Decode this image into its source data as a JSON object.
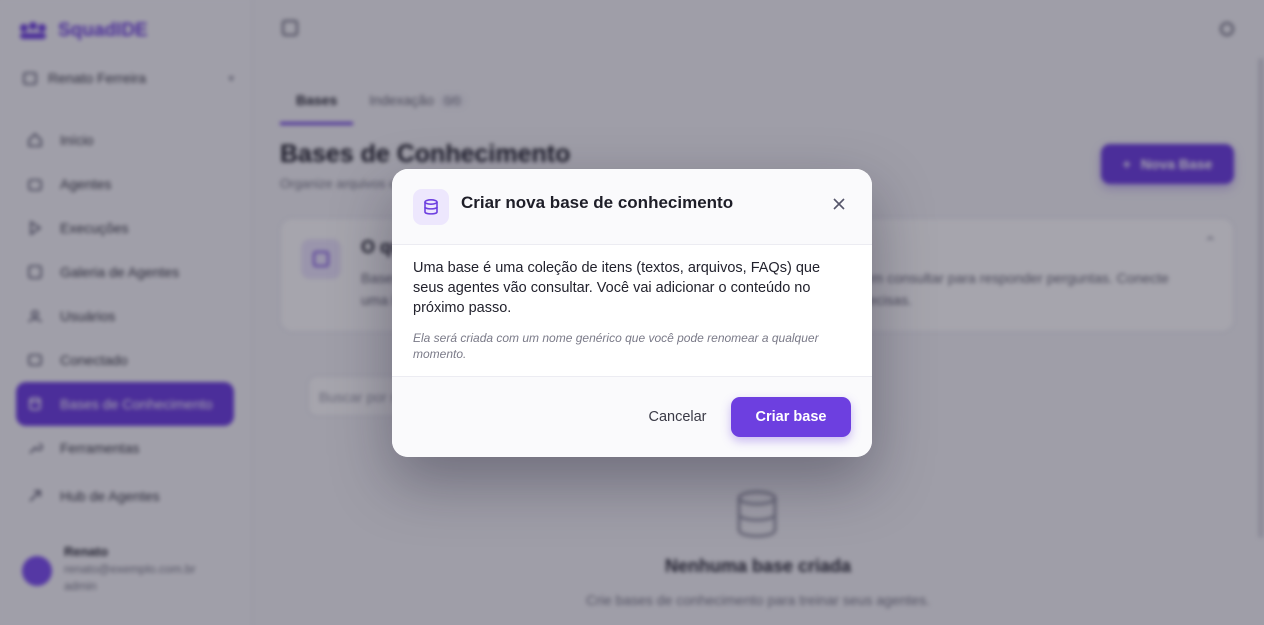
{
  "app": {
    "name": "SquadIDE"
  },
  "workspace": {
    "name": "Renato Ferreira"
  },
  "sidebar": {
    "items": [
      {
        "label": "Início",
        "icon": "home-icon"
      },
      {
        "label": "Agentes",
        "icon": "bot-icon"
      },
      {
        "label": "Execuções",
        "icon": "play-icon"
      },
      {
        "label": "Galeria de Agentes",
        "icon": "grid-icon"
      },
      {
        "label": "Usuários",
        "icon": "users-icon"
      },
      {
        "label": "Conectado",
        "icon": "plug-icon"
      },
      {
        "label": "Bases de Conhecimento",
        "icon": "database-icon",
        "active": true
      },
      {
        "label": "Ferramentas",
        "icon": "wrench-icon"
      },
      {
        "label": "Hub de Agentes",
        "icon": "share-icon"
      }
    ]
  },
  "user": {
    "name": "Renato",
    "email": "renato@exemplo.com.br",
    "role": "admin"
  },
  "tabs": [
    {
      "label": "Bases",
      "active": true
    },
    {
      "label": "Indexação",
      "count": "0/0"
    }
  ],
  "page": {
    "title": "Bases de Conhecimento",
    "subtitle": "Organize arquivos e conteúdos para seus agentes",
    "new_button": "Nova Base"
  },
  "info_card": {
    "title": "O que são bases",
    "text": "Bases de conhecimento guardam textos, arquivos e FAQs que seus agentes podem consultar para responder perguntas. Conecte uma base a um agente para ampliar o que ele sabe e deixar as respostas mais precisas."
  },
  "search": {
    "placeholder": "Buscar por nome..."
  },
  "empty_state": {
    "title": "Nenhuma base criada",
    "subtitle": "Crie bases de conhecimento para treinar seus agentes."
  },
  "modal": {
    "title": "Criar nova base de conhecimento",
    "body": "Uma base é uma coleção de itens (textos, arquivos, FAQs) que seus agentes vão consultar. Você vai adicionar o conteúdo no próximo passo.",
    "note": "Ela será criada com um nome genérico que você pode renomear a qualquer momento.",
    "cancel_label": "Cancelar",
    "create_label": "Criar base"
  },
  "colors": {
    "accent": "#6d3fe0",
    "overlay": "rgba(20,18,40,0.38)"
  }
}
